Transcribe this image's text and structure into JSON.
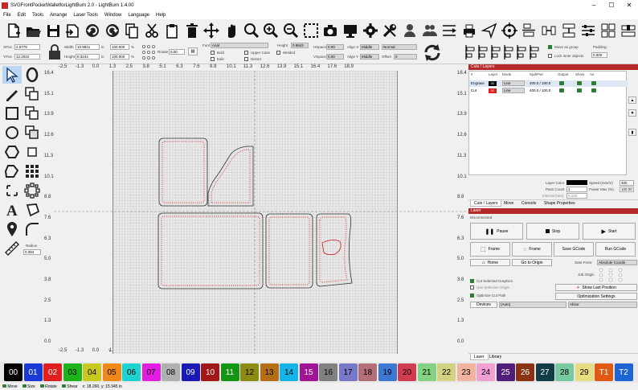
{
  "window": {
    "title": "SVGFrontPocketWalletforLightBurn 2.0 - LightBurn 1.4.00",
    "controls": [
      "–",
      "☐",
      "✕"
    ]
  },
  "menu": [
    "File",
    "Edit",
    "Tools",
    "Arrange",
    "Laser Tools",
    "Window",
    "Language",
    "Help"
  ],
  "toolbar_icons": [
    "new-file-icon",
    "open-folder-icon",
    "save-icon",
    "import-icon",
    "undo-icon",
    "redo-icon",
    "copy-icon",
    "cut-icon",
    "paste-icon",
    "delete-icon",
    "move-icon",
    "hand-icon",
    "zoom-fit-icon",
    "zoom-in-icon",
    "zoom-out-icon",
    "select-frame-icon",
    "camera-icon",
    "monitor-icon",
    "settings-icon",
    "tools-icon",
    "users-icon",
    "user-group-icon",
    "path-optimize-icon",
    "print-icon",
    "send-icon",
    "target-icon",
    "align-icon",
    "distribute-h-icon",
    "distribute-v-icon",
    "sliders-icon",
    "grid-icon",
    "nodes-icon"
  ],
  "props": {
    "xpos_label": "XPos",
    "xpos": "2.5779",
    "ypos_label": "YPos",
    "ypos": "12.2022",
    "width_label": "Width",
    "width": "10.9841",
    "height_label": "Height",
    "height": "8.3244",
    "unit": "in",
    "scale_x": "100.000",
    "scale_y": "100.000",
    "pct": "%",
    "rotate_label": "Rotate",
    "rotate": "0.00",
    "font_label": "Font",
    "font": "Arial",
    "height2_label": "Height",
    "height2": "0.9843",
    "hspace_label": "HSpace",
    "hspace": "0.00",
    "vspace_label": "VSpace",
    "vspace": "0.00",
    "alignx_label": "Align X",
    "alignx": "Middle",
    "aligny_label": "Align Y",
    "aligny": "Middle",
    "normal": "Normal",
    "offset_label": "Offset",
    "offset": "0",
    "bold": "Bold",
    "italic": "Italic",
    "upper": "Upper Case",
    "welded": "Welded",
    "distort": "Distort",
    "move_group": "Move as group",
    "lock_inner": "Lock inner objects",
    "padding_label": "Padding:",
    "padding": "0.000"
  },
  "ruler_top": [
    "-2.5",
    "-1.3",
    "0.0",
    "1.3",
    "2.5",
    "3.8",
    "5.1",
    "6.3",
    "7.6",
    "8.8",
    "10.1",
    "11.3",
    "12.6",
    "13.9",
    "15.1",
    "16.4",
    "17.6",
    "18.9"
  ],
  "ruler_left": [
    "16.4",
    "15.1",
    "13.9",
    "12.6",
    "11.3",
    "10.1",
    "8.8",
    "7.6",
    "6.3",
    "5.0",
    "3.8",
    "2.5",
    "1.3",
    "0.0"
  ],
  "left_tools": {
    "radius_label": "Radius",
    "radius": "0.394"
  },
  "cuts": {
    "header": "Cuts / Layers",
    "cols": [
      "#",
      "Layer",
      "Mode",
      "Spd/Pwr",
      "Output",
      "Show",
      "Air"
    ],
    "rows": [
      {
        "name": "Engrave",
        "layer": "00",
        "color": "#000000",
        "mode": "Line",
        "spdpwr": "400.0 / 100.0"
      },
      {
        "name": "Cut",
        "layer": "02",
        "color": "#e02020",
        "mode": "Line",
        "spdpwr": "400.0 / 100.0"
      }
    ],
    "layer_color_label": "Layer Color",
    "speed_label": "Speed (mm/m)",
    "speed": "400",
    "pass_label": "Pass Count",
    "pass": "1",
    "power_label": "Power Max (%)",
    "power": "100.00",
    "interval_label": "Interval (mm)",
    "interval": "0.100"
  },
  "tabs1": [
    "Cuts / Layers",
    "Move",
    "Console",
    "Shape Properties"
  ],
  "laser": {
    "header": "Laser",
    "status": "Disconnected",
    "pause": "Pause",
    "stop": "Stop",
    "start": "Start",
    "frame1": "Frame",
    "frame2": "Frame",
    "save_gcode": "Save GCode",
    "run_gcode": "Run GCode",
    "home": "Home",
    "goto_origin": "Go to Origin",
    "start_from_label": "Start From:",
    "start_from": "Absolute Coords",
    "job_origin_label": "Job Origin",
    "cut_selected": "Cut Selected Graphics",
    "use_selection": "Use Selection Origin",
    "optimize": "Optimize Cut Path",
    "show_last": "Show Last Position",
    "opt_settings": "Optimization Settings",
    "devices": "Devices",
    "device": "(Auto)",
    "profile": "Absor"
  },
  "tabs2": [
    "Laser",
    "Library"
  ],
  "palette": [
    {
      "l": "00",
      "c": "#000000",
      "t": "#ffffff"
    },
    {
      "l": "01",
      "c": "#1a3ad8",
      "t": "#ffffff"
    },
    {
      "l": "02",
      "c": "#e02020",
      "t": "#ffffff"
    },
    {
      "l": "03",
      "c": "#1db31d",
      "t": "#000000"
    },
    {
      "l": "04",
      "c": "#c8c821",
      "t": "#000000"
    },
    {
      "l": "05",
      "c": "#ef8a1a",
      "t": "#000000"
    },
    {
      "l": "06",
      "c": "#1ed2d2",
      "t": "#000000"
    },
    {
      "l": "07",
      "c": "#e11ee1",
      "t": "#000000"
    },
    {
      "l": "08",
      "c": "#b0b0b0",
      "t": "#000000"
    },
    {
      "l": "09",
      "c": "#1a1ab4",
      "t": "#ffffff"
    },
    {
      "l": "10",
      "c": "#a01818",
      "t": "#ffffff"
    },
    {
      "l": "11",
      "c": "#149614",
      "t": "#ffffff"
    },
    {
      "l": "12",
      "c": "#8c8c14",
      "t": "#000000"
    },
    {
      "l": "13",
      "c": "#b46e14",
      "t": "#000000"
    },
    {
      "l": "14",
      "c": "#14b4e6",
      "t": "#000000"
    },
    {
      "l": "15",
      "c": "#a01496",
      "t": "#ffffff"
    },
    {
      "l": "16",
      "c": "#808080",
      "t": "#000000"
    },
    {
      "l": "17",
      "c": "#7878c8",
      "t": "#000000"
    },
    {
      "l": "18",
      "c": "#b46e78",
      "t": "#000000"
    },
    {
      "l": "19",
      "c": "#3c78d2",
      "t": "#000000"
    },
    {
      "l": "20",
      "c": "#d23c50",
      "t": "#000000"
    },
    {
      "l": "21",
      "c": "#82d282",
      "t": "#000000"
    },
    {
      "l": "22",
      "c": "#d2d282",
      "t": "#000000"
    },
    {
      "l": "23",
      "c": "#f0b4a0",
      "t": "#000000"
    },
    {
      "l": "24",
      "c": "#f0a0d2",
      "t": "#000000"
    },
    {
      "l": "25",
      "c": "#501e78",
      "t": "#ffffff"
    },
    {
      "l": "26",
      "c": "#8c3214",
      "t": "#ffffff"
    },
    {
      "l": "27",
      "c": "#143c46",
      "t": "#ffffff"
    },
    {
      "l": "28",
      "c": "#78c8a0",
      "t": "#000000"
    },
    {
      "l": "29",
      "c": "#e6dc82",
      "t": "#000000"
    },
    {
      "l": "T1",
      "c": "#e05a14",
      "t": "#ffffff"
    },
    {
      "l": "T2",
      "c": "#1e64d2",
      "t": "#ffffff"
    }
  ],
  "status": {
    "move": "Move",
    "size": "Size",
    "rotate": "Rotate",
    "shear": "Shear",
    "coords": "x: 18.260, y: 15.945 in"
  }
}
